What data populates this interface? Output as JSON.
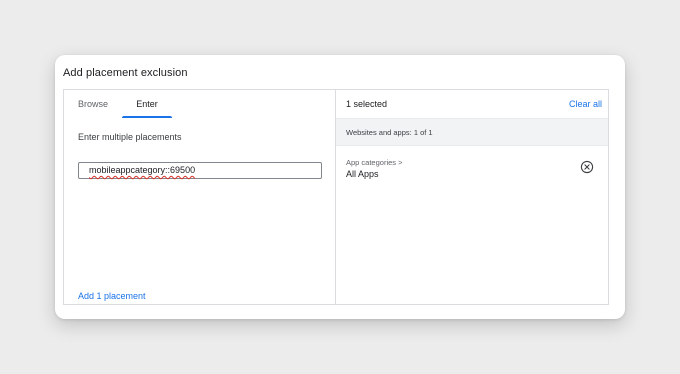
{
  "dialog": {
    "title": "Add placement exclusion"
  },
  "left": {
    "tabs": [
      {
        "label": "Browse",
        "active": false
      },
      {
        "label": "Enter",
        "active": true
      }
    ],
    "instruction": "Enter multiple placements",
    "input_value": "mobileappcategory::69500",
    "add_link": "Add 1 placement"
  },
  "right": {
    "selected_count": "1 selected",
    "clear_all": "Clear all",
    "section_header": "Websites and apps: 1 of 1",
    "items": [
      {
        "path": "App categories >",
        "name": "All Apps",
        "remove_icon": "close-circle-icon"
      }
    ]
  },
  "colors": {
    "accent": "#1a73e8",
    "background": "#ececec",
    "section_bar": "#f1f3f4"
  }
}
